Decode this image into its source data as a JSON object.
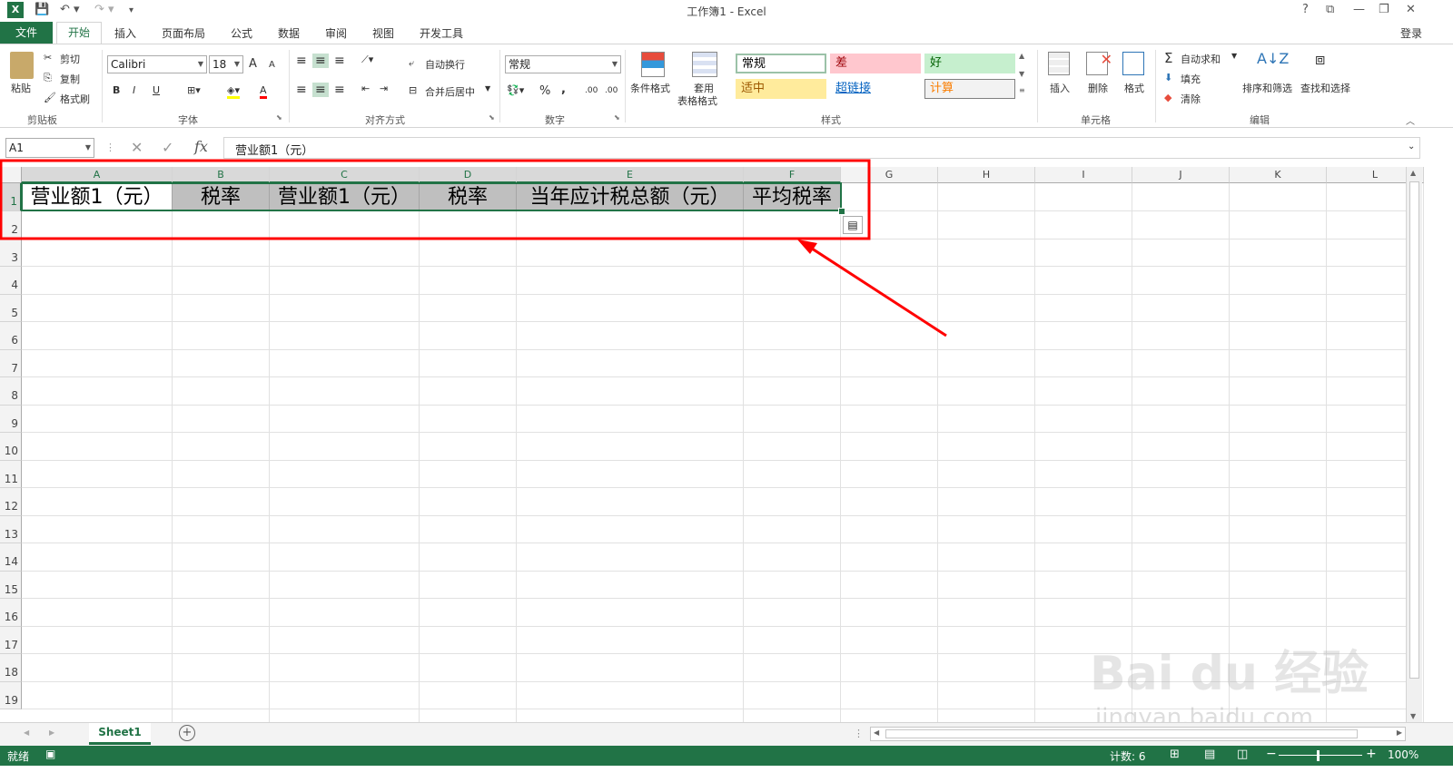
{
  "window": {
    "title": "工作簿1 - Excel",
    "controls": [
      "?",
      "⧉",
      "—",
      "❐",
      "✕"
    ],
    "login": "登录"
  },
  "tabs": {
    "file": "文件",
    "items": [
      "开始",
      "插入",
      "页面布局",
      "公式",
      "数据",
      "审阅",
      "视图",
      "开发工具"
    ]
  },
  "ribbon": {
    "clipboard": {
      "paste": "粘贴",
      "cut": "剪切",
      "copy": "复制",
      "format_painter": "格式刷",
      "label": "剪贴板"
    },
    "font": {
      "name": "Calibri",
      "size": "18",
      "bold": "B",
      "italic": "I",
      "underline": "U",
      "grow": "A",
      "shrink": "A",
      "color": "A",
      "label": "字体"
    },
    "alignment": {
      "wrap": "自动换行",
      "merge": "合并后居中",
      "label": "对齐方式"
    },
    "number": {
      "format": "常规",
      "percent": "%",
      "comma": ",",
      "inc_decimal": ".00",
      "dec_decimal": ".00",
      "label": "数字"
    },
    "styles": {
      "conditional": "条件格式",
      "table_1": "套用",
      "table_2": "表格格式",
      "cells": [
        {
          "text": "常规",
          "bg": "#ffffff",
          "fg": "#000000",
          "border": "#9bc2a8"
        },
        {
          "text": "差",
          "bg": "#ffc7ce",
          "fg": "#9c0006",
          "border": "#ffc7ce"
        },
        {
          "text": "好",
          "bg": "#c6efce",
          "fg": "#006100",
          "border": "#c6efce"
        },
        {
          "text": "适中",
          "bg": "#ffeb9c",
          "fg": "#9c5700",
          "border": "#ffeb9c"
        },
        {
          "text": "超链接",
          "bg": "#ffffff",
          "fg": "#0563c1",
          "border": "#ffffff"
        },
        {
          "text": "计算",
          "bg": "#f2f2f2",
          "fg": "#fa7d00",
          "border": "#7f7f7f"
        }
      ],
      "label": "样式"
    },
    "cells": {
      "insert": "插入",
      "delete": "删除",
      "format": "格式",
      "label": "单元格"
    },
    "editing": {
      "autosum": "自动求和",
      "fill": "填充",
      "clear": "清除",
      "sort": "排序和筛选",
      "find": "查找和选择",
      "label": "编辑"
    }
  },
  "formula_bar": {
    "name_box": "A1",
    "cancel": "✕",
    "enter": "✓",
    "fx": "fx",
    "content": "营业额1（元）"
  },
  "grid": {
    "columns": [
      "A",
      "B",
      "C",
      "D",
      "E",
      "F",
      "G",
      "H",
      "I",
      "J",
      "K",
      "L"
    ],
    "rows": [
      "1",
      "2",
      "3",
      "4",
      "5",
      "6",
      "7",
      "8",
      "9",
      "10",
      "11",
      "12",
      "13",
      "14",
      "15",
      "16",
      "17",
      "18",
      "19"
    ],
    "row1": [
      "营业额1（元）",
      "税率",
      "营业额1（元）",
      "税率",
      "当年应计税总额（元）",
      "平均税率"
    ]
  },
  "sheets": {
    "active": "Sheet1",
    "add": "+"
  },
  "status": {
    "ready": "就绪",
    "count": "计数: 6",
    "zoom": "100%"
  },
  "watermark": {
    "brand": "Bai du 经验",
    "url": "jingyan.baidu.com"
  },
  "colors": {
    "accent": "#217346",
    "annotation": "#ff0000",
    "selected_fill": "#bfbfbf"
  }
}
